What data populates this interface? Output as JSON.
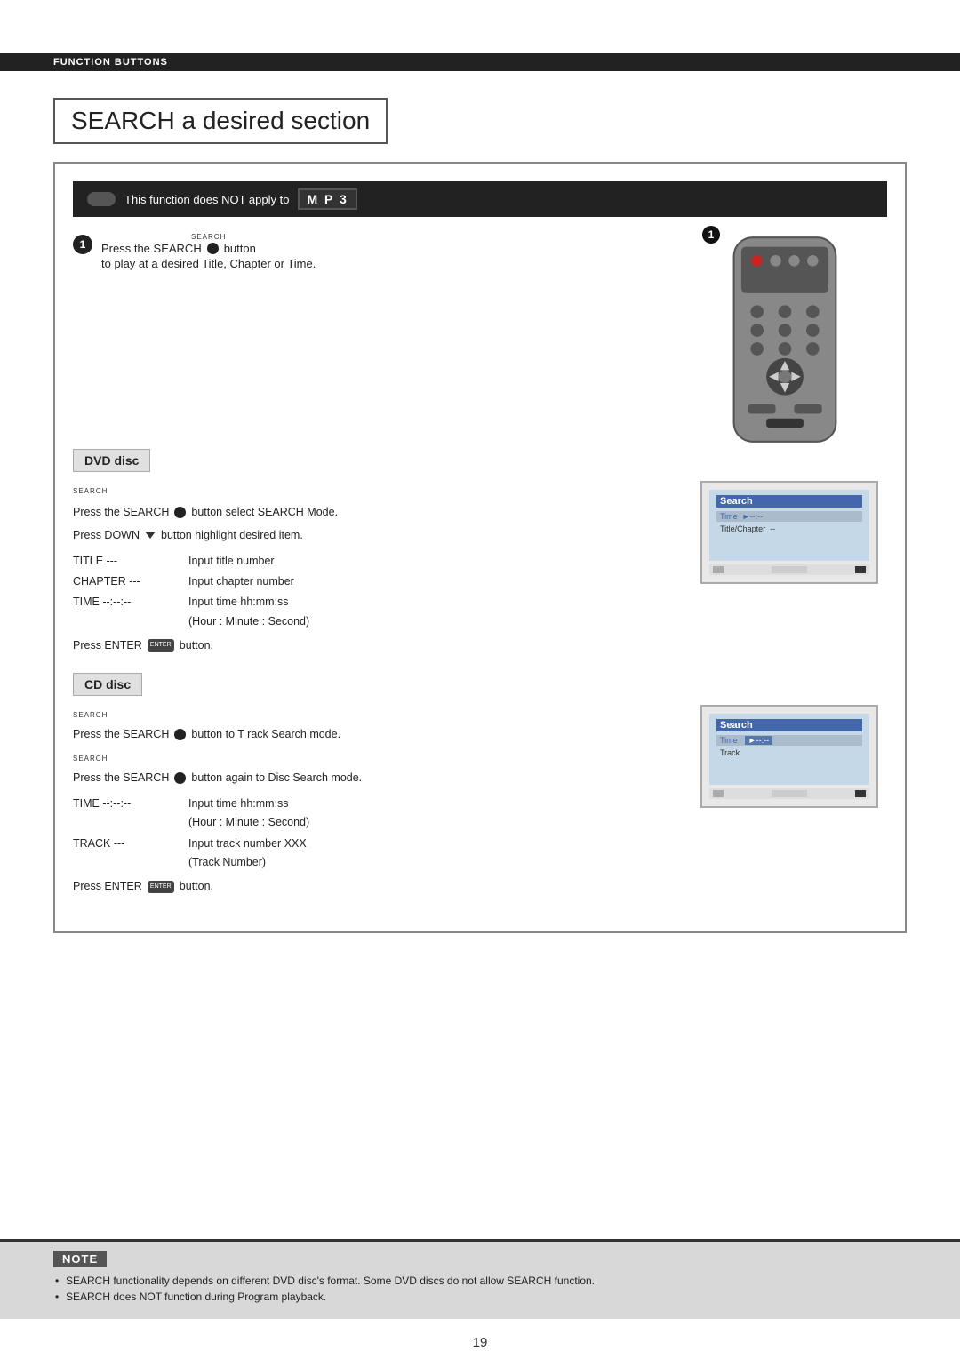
{
  "header": {
    "label": "FUNCTION BUTTONS"
  },
  "section": {
    "title": "SEARCH a desired   section",
    "mp3_notice": "This function does NOT apply to",
    "mp3_badge": "M P 3",
    "step1": {
      "label": "SEARCH",
      "text": "Press the  SEARCH",
      "text2": "button",
      "text3": "to play at  a desired Title, Chapter or  Time."
    }
  },
  "dvd_disc": {
    "title": "DVD disc",
    "line1_search": "SEARCH",
    "line1": "Press the SEARCH",
    "line1b": "button select SEARCH Mode.",
    "line2a": "Press DOWN",
    "line2b": "button highlight desired  item.",
    "title_label": "TITLE ---",
    "title_desc": "Input title  number",
    "chapter_label": "CHAPTER ---",
    "chapter_desc": "Input chapter  number",
    "time_label": "TIME --:--:--",
    "time_desc": "Input time  hh:mm:ss",
    "time_desc2": "(Hour : Minute : Second)",
    "enter_label": "Press ENTER",
    "enter_label2": "button.",
    "screen": {
      "title": "Search",
      "items": [
        "Time",
        "Title/Chapter"
      ]
    }
  },
  "cd_disc": {
    "title": "CD disc",
    "line1_search": "SEARCH",
    "line1": "Press the SEARCH",
    "line1b": "button to T rack Search mode.",
    "line2_search": "SEARCH",
    "line2": "Press the SEARCH",
    "line2b": "button again to  Disc Search mode.",
    "time_label": "TIME --:--:--",
    "time_desc": "Input time  hh:mm:ss",
    "time_desc2": "(Hour : Minute : Second)",
    "track_label": "TRACK ---",
    "track_desc": "Input track number   XXX",
    "track_desc2": "(Track Number)",
    "enter_label": "Press ENTER",
    "enter_label2": "button.",
    "screen": {
      "title": "Search",
      "items": [
        "Time",
        "Track"
      ]
    }
  },
  "note": {
    "title": "NOTE",
    "items": [
      "SEARCH functionality depends on different DVD disc's format. Some  DVD discs do  not allow SEARCH  function.",
      "SEARCH does NOT  function during Program  playback."
    ]
  },
  "page_number": "19"
}
